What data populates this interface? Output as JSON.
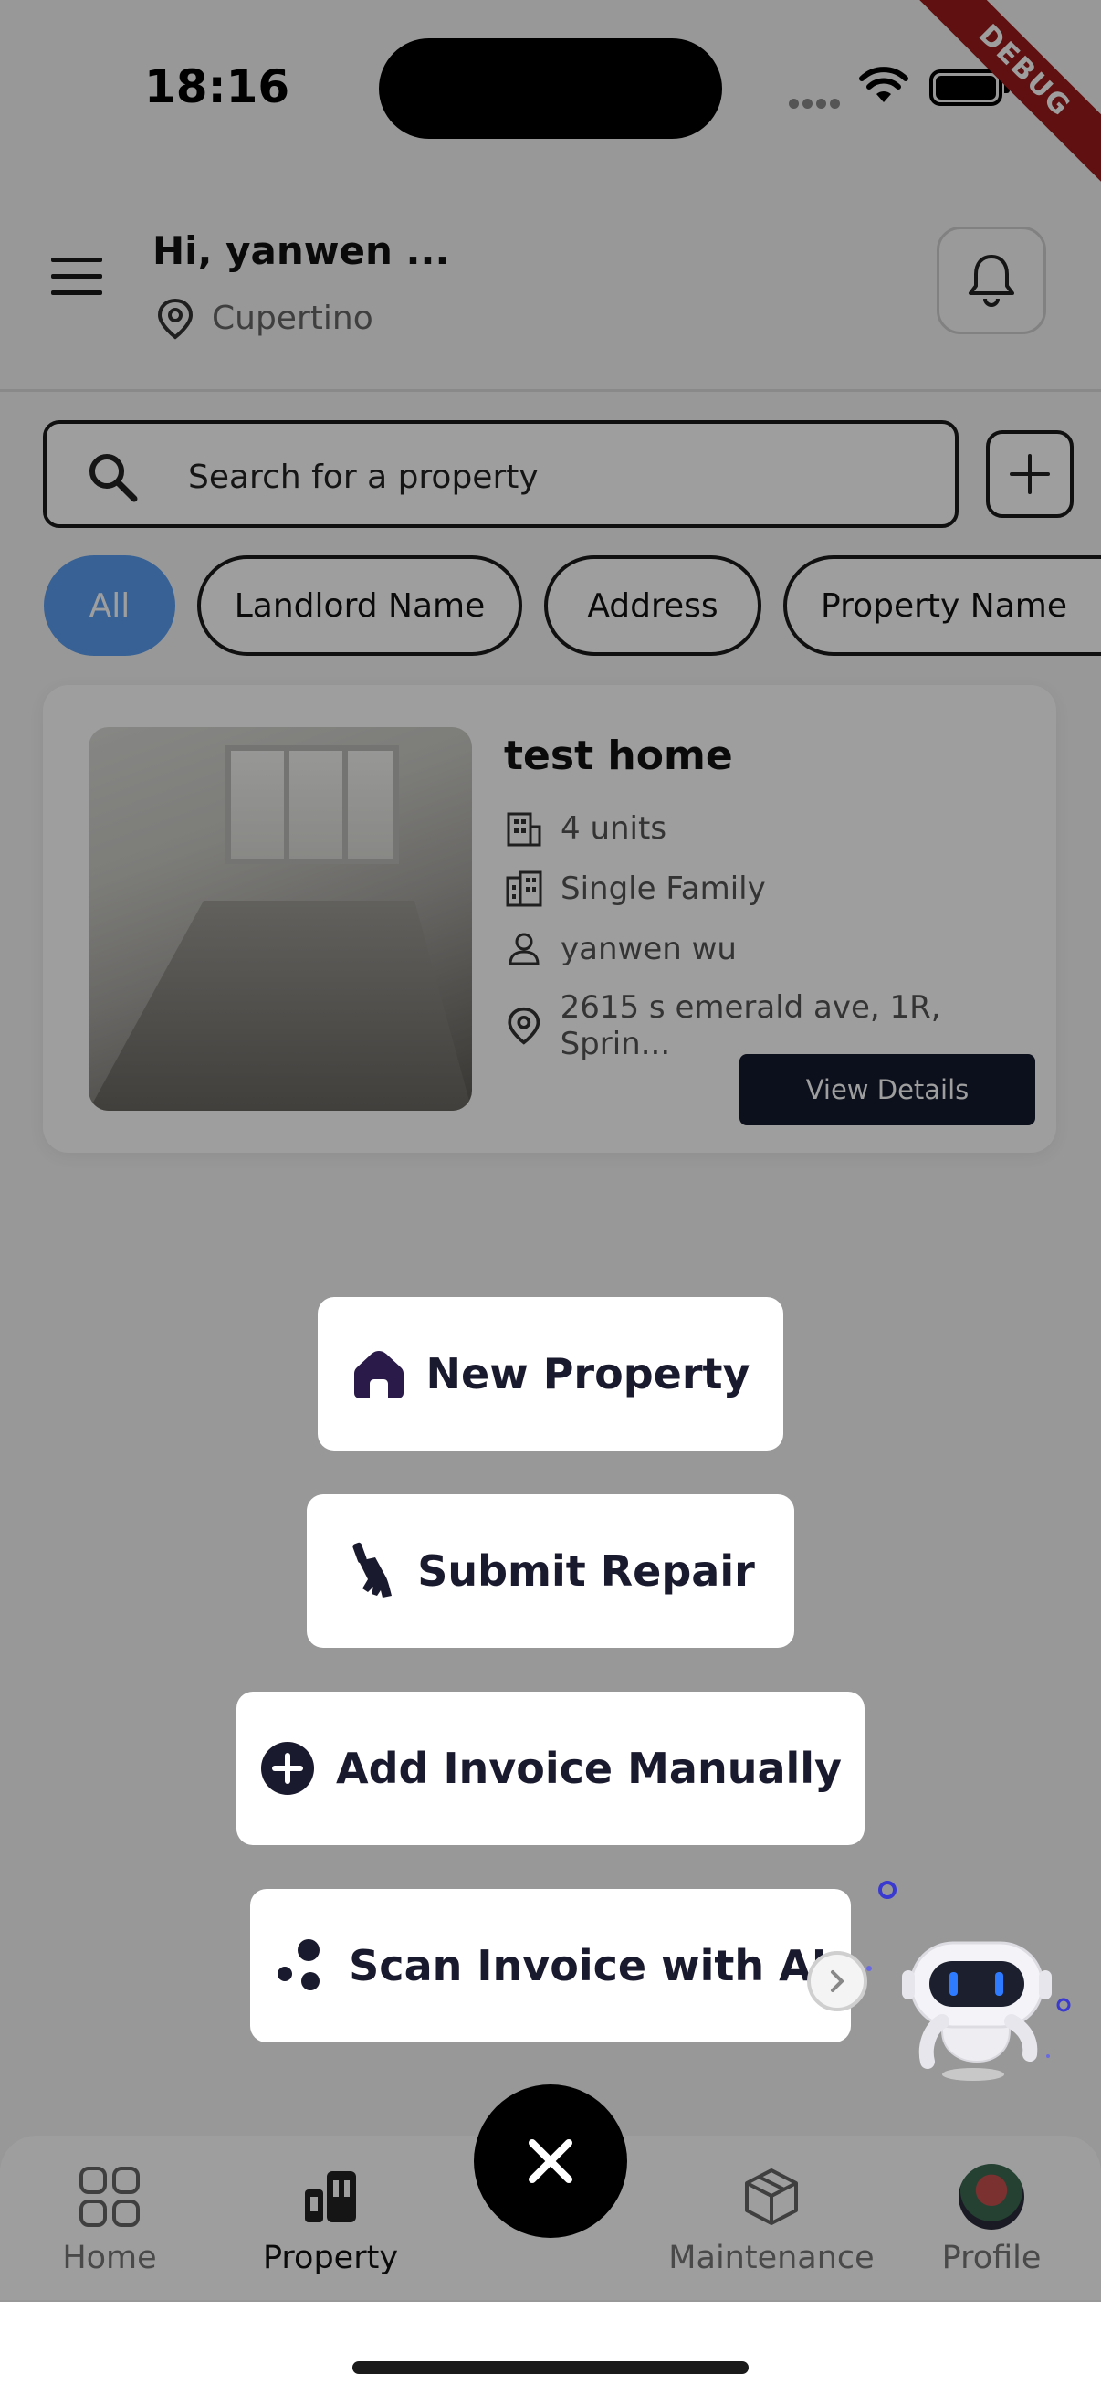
{
  "status_bar": {
    "time": "18:16",
    "debug_label": "DEBUG"
  },
  "header": {
    "greeting": "Hi, yanwen ...",
    "location": "Cupertino"
  },
  "search": {
    "placeholder": "Search for a property"
  },
  "filters": [
    {
      "label": "All",
      "active": true
    },
    {
      "label": "Landlord Name",
      "active": false
    },
    {
      "label": "Address",
      "active": false
    },
    {
      "label": "Property Name",
      "active": false
    }
  ],
  "property_card": {
    "title": "test home",
    "units": "4 units",
    "type": "Single Family",
    "owner": "yanwen wu",
    "address": "2615  s emerald ave, 1R, Sprin...",
    "view_label": "View Details"
  },
  "actions": {
    "new_property": "New Property",
    "submit_repair": "Submit Repair",
    "add_invoice": "Add Invoice Manually",
    "scan_invoice": "Scan Invoice with AI"
  },
  "nav": {
    "home": "Home",
    "property": "Property",
    "maintenance": "Maintenance",
    "profile": "Profile"
  },
  "colors": {
    "accent": "#5b9ef0",
    "primary_dark": "#141a2e",
    "overlay": "rgba(0,0,0,0.38)"
  },
  "icons": {
    "menu": "hamburger-menu-icon",
    "location": "map-pin-icon",
    "bell": "bell-icon",
    "search": "search-icon",
    "add": "plus-icon",
    "close": "close-icon",
    "assistant": "robot-assistant-icon"
  }
}
